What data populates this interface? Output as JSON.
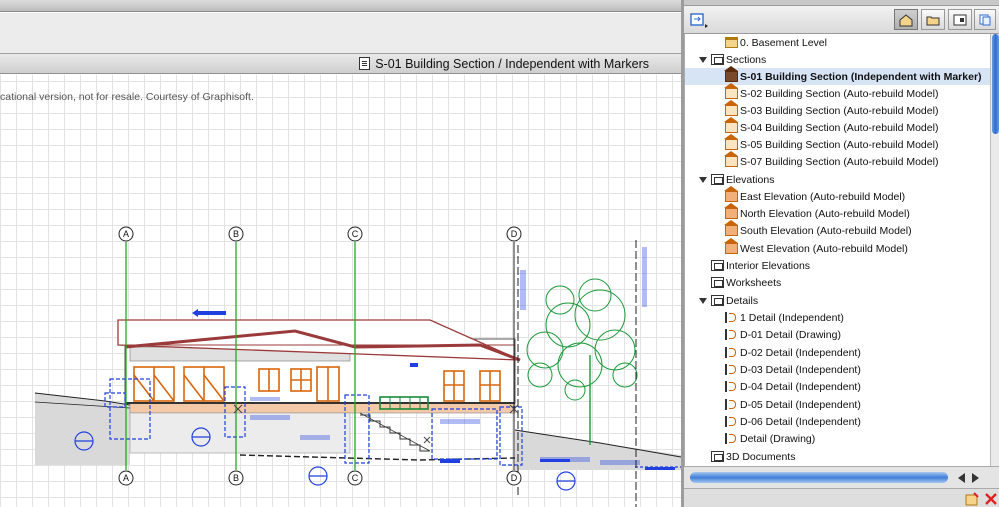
{
  "window": {
    "title": "S-01 Building Section / Independent with Markers",
    "watermark": "cational version, not for resale. Courtesy of Graphisoft."
  },
  "grid_lines": [
    "A",
    "B",
    "C",
    "D"
  ],
  "navigator": {
    "toolbar_icons": [
      "project-map-icon",
      "layout-book-icon",
      "view-map-icon",
      "publisher-icon"
    ],
    "items": [
      {
        "label": "0. Basement Level",
        "icon": "folder-icon",
        "indent": 2
      },
      {
        "label": "Sections",
        "icon": "section-folder-icon",
        "indent": 1,
        "expanded": true
      },
      {
        "label": "S-01 Building Section (Independent with Marker)",
        "icon": "section-icon",
        "indent": 2,
        "selected": true
      },
      {
        "label": "S-02 Building Section (Auto-rebuild Model)",
        "icon": "section-icon",
        "indent": 2
      },
      {
        "label": "S-03 Building Section (Auto-rebuild Model)",
        "icon": "section-icon",
        "indent": 2
      },
      {
        "label": "S-04 Building Section (Auto-rebuild Model)",
        "icon": "section-icon",
        "indent": 2
      },
      {
        "label": "S-05 Building Section (Auto-rebuild Model)",
        "icon": "section-icon",
        "indent": 2
      },
      {
        "label": "S-07 Building Section (Auto-rebuild Model)",
        "icon": "section-icon",
        "indent": 2
      },
      {
        "label": "Elevations",
        "icon": "elevation-folder-icon",
        "indent": 1,
        "expanded": true
      },
      {
        "label": "East Elevation (Auto-rebuild Model)",
        "icon": "elevation-icon",
        "indent": 2
      },
      {
        "label": "North Elevation (Auto-rebuild Model)",
        "icon": "elevation-icon",
        "indent": 2
      },
      {
        "label": "South Elevation (Auto-rebuild Model)",
        "icon": "elevation-icon",
        "indent": 2
      },
      {
        "label": "West Elevation (Auto-rebuild Model)",
        "icon": "elevation-icon",
        "indent": 2
      },
      {
        "label": "Interior Elevations",
        "icon": "interior-elevation-icon",
        "indent": 1
      },
      {
        "label": "Worksheets",
        "icon": "worksheet-icon",
        "indent": 1
      },
      {
        "label": "Details",
        "icon": "details-folder-icon",
        "indent": 1,
        "expanded": true
      },
      {
        "label": "1 Detail (Independent)",
        "icon": "detail-icon",
        "indent": 2
      },
      {
        "label": "D-01 Detail (Drawing)",
        "icon": "detail-icon",
        "indent": 2
      },
      {
        "label": "D-02 Detail (Independent)",
        "icon": "detail-icon",
        "indent": 2
      },
      {
        "label": "D-03 Detail (Independent)",
        "icon": "detail-icon",
        "indent": 2
      },
      {
        "label": "D-04 Detail (Independent)",
        "icon": "detail-icon",
        "indent": 2
      },
      {
        "label": "D-05 Detail (Independent)",
        "icon": "detail-icon",
        "indent": 2
      },
      {
        "label": "D-06 Detail (Independent)",
        "icon": "detail-icon",
        "indent": 2
      },
      {
        "label": "Detail (Drawing)",
        "icon": "detail-icon",
        "indent": 2
      },
      {
        "label": "3D Documents",
        "icon": "3d-documents-icon",
        "indent": 1
      }
    ]
  },
  "colors": {
    "selection": "#d7e4f5",
    "accent": "#2f6bcc",
    "grid_line": "#22aa22",
    "roof": "#9b3a3a"
  }
}
